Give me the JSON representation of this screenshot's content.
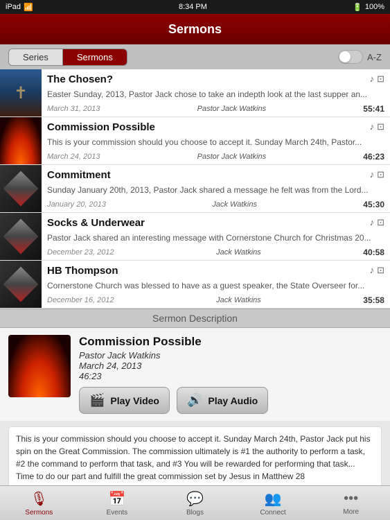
{
  "statusBar": {
    "left": "iPad",
    "time": "8:34 PM",
    "battery": "100%",
    "signal": "wifi"
  },
  "header": {
    "title": "Sermons"
  },
  "segmentControl": {
    "options": [
      "Series",
      "Sermons"
    ],
    "activeIndex": 1,
    "azToggle": "A-Z"
  },
  "sermons": [
    {
      "title": "The Chosen?",
      "description": "Easter Sunday, 2013, Pastor Jack chose to take an indepth look at the last supper an...",
      "date": "March 31, 2013",
      "pastor": "Pastor Jack Watkins",
      "duration": "55:41",
      "thumbType": "chosen"
    },
    {
      "title": "Commission Possible",
      "description": "This is your commission should you choose to accept it. Sunday March 24th, Pastor...",
      "date": "March 24, 2013",
      "pastor": "Pastor Jack Watkins",
      "duration": "46:23",
      "thumbType": "fire"
    },
    {
      "title": "Commitment",
      "description": "Sunday January 20th, 2013, Pastor Jack shared a message he felt was from the Lord...",
      "date": "January 20, 2013",
      "pastor": "Jack Watkins",
      "duration": "45:30",
      "thumbType": "cube"
    },
    {
      "title": "Socks & Underwear",
      "description": "Pastor Jack shared an interesting message with Cornerstone Church for Christmas 20...",
      "date": "December 23, 2012",
      "pastor": "Jack Watkins",
      "duration": "40:58",
      "thumbType": "cube"
    },
    {
      "title": "HB Thompson",
      "description": "Cornerstone Church was blessed to have as a guest speaker, the State Overseer for...",
      "date": "December 16, 2012",
      "pastor": "Jack Watkins",
      "duration": "35:58",
      "thumbType": "cube"
    }
  ],
  "divider": {
    "label": "Sermon Description"
  },
  "detail": {
    "title": "Commission Possible",
    "pastor": "Pastor Jack Watkins",
    "date": "March 24, 2013",
    "duration": "46:23",
    "playVideoLabel": "Play Video",
    "playAudioLabel": "Play Audio",
    "description": "This is your commission should you choose to accept it. Sunday March 24th, Pastor Jack put his spin on the Great Commission. The commission ultimately is #1 the authority to perform a task, #2 the command to perform that task, and #3 You will be rewarded for performing that task... Time to do our part and fulfill the great commission set by Jesus in Matthew 28"
  },
  "tabs": [
    {
      "label": "Sermons",
      "icon": "microphone",
      "active": true
    },
    {
      "label": "Events",
      "icon": "calendar",
      "active": false
    },
    {
      "label": "Blogs",
      "icon": "speech-bubble",
      "active": false
    },
    {
      "label": "Connect",
      "icon": "people",
      "active": false
    },
    {
      "label": "More",
      "icon": "dots",
      "active": false
    }
  ]
}
